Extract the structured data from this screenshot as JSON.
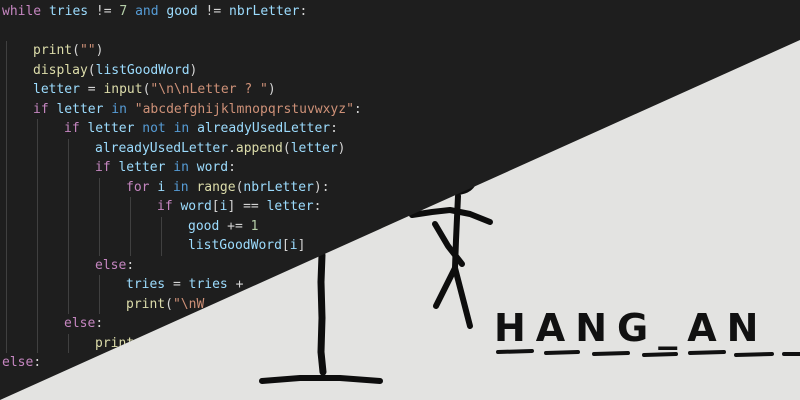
{
  "code_lines": [
    {
      "indent": 0,
      "tokens": [
        [
          "kw",
          "while"
        ],
        [
          "op",
          " "
        ],
        [
          "var",
          "tries"
        ],
        [
          "op",
          " != "
        ],
        [
          "num",
          "7"
        ],
        [
          "op",
          " "
        ],
        [
          "kb",
          "and"
        ],
        [
          "op",
          " "
        ],
        [
          "var",
          "good"
        ],
        [
          "op",
          " != "
        ],
        [
          "var",
          "nbrLetter"
        ],
        [
          "op",
          ":"
        ]
      ]
    },
    {
      "indent": 0,
      "tokens": []
    },
    {
      "indent": 1,
      "tokens": [
        [
          "fn",
          "print"
        ],
        [
          "op",
          "("
        ],
        [
          "str",
          "\"\""
        ],
        [
          "op",
          ")"
        ]
      ]
    },
    {
      "indent": 1,
      "tokens": [
        [
          "fn",
          "display"
        ],
        [
          "op",
          "("
        ],
        [
          "var",
          "listGoodWord"
        ],
        [
          "op",
          ")"
        ]
      ]
    },
    {
      "indent": 1,
      "tokens": [
        [
          "var",
          "letter"
        ],
        [
          "op",
          " = "
        ],
        [
          "fn",
          "input"
        ],
        [
          "op",
          "("
        ],
        [
          "str",
          "\"\\n\\nLetter ? \""
        ],
        [
          "op",
          ")"
        ]
      ]
    },
    {
      "indent": 1,
      "tokens": [
        [
          "kw",
          "if"
        ],
        [
          "op",
          " "
        ],
        [
          "var",
          "letter"
        ],
        [
          "op",
          " "
        ],
        [
          "kb",
          "in"
        ],
        [
          "op",
          " "
        ],
        [
          "str",
          "\"abcdefghijklmnopqrstuvwxyz\""
        ],
        [
          "op",
          ":"
        ]
      ]
    },
    {
      "indent": 2,
      "tokens": [
        [
          "kw",
          "if"
        ],
        [
          "op",
          " "
        ],
        [
          "var",
          "letter"
        ],
        [
          "op",
          " "
        ],
        [
          "kb",
          "not"
        ],
        [
          "op",
          " "
        ],
        [
          "kb",
          "in"
        ],
        [
          "op",
          " "
        ],
        [
          "var",
          "alreadyUsedLetter"
        ],
        [
          "op",
          ":"
        ]
      ]
    },
    {
      "indent": 3,
      "tokens": [
        [
          "var",
          "alreadyUsedLetter"
        ],
        [
          "op",
          "."
        ],
        [
          "fn",
          "append"
        ],
        [
          "op",
          "("
        ],
        [
          "var",
          "letter"
        ],
        [
          "op",
          ")"
        ]
      ]
    },
    {
      "indent": 3,
      "tokens": [
        [
          "kw",
          "if"
        ],
        [
          "op",
          " "
        ],
        [
          "var",
          "letter"
        ],
        [
          "op",
          " "
        ],
        [
          "kb",
          "in"
        ],
        [
          "op",
          " "
        ],
        [
          "var",
          "word"
        ],
        [
          "op",
          ":"
        ]
      ]
    },
    {
      "indent": 4,
      "tokens": [
        [
          "kw",
          "for"
        ],
        [
          "op",
          " "
        ],
        [
          "var",
          "i"
        ],
        [
          "op",
          " "
        ],
        [
          "kb",
          "in"
        ],
        [
          "op",
          " "
        ],
        [
          "fn",
          "range"
        ],
        [
          "op",
          "("
        ],
        [
          "var",
          "nbrLetter"
        ],
        [
          "op",
          "):"
        ]
      ]
    },
    {
      "indent": 5,
      "tokens": [
        [
          "kw",
          "if"
        ],
        [
          "op",
          " "
        ],
        [
          "var",
          "word"
        ],
        [
          "op",
          "["
        ],
        [
          "var",
          "i"
        ],
        [
          "op",
          "] == "
        ],
        [
          "var",
          "letter"
        ],
        [
          "op",
          ":"
        ]
      ]
    },
    {
      "indent": 6,
      "tokens": [
        [
          "var",
          "good"
        ],
        [
          "op",
          " += "
        ],
        [
          "num",
          "1"
        ]
      ]
    },
    {
      "indent": 6,
      "tokens": [
        [
          "var",
          "listGoodWord"
        ],
        [
          "op",
          "["
        ],
        [
          "var",
          "i"
        ],
        [
          "op",
          "]"
        ]
      ]
    },
    {
      "indent": 3,
      "tokens": [
        [
          "kw",
          "else"
        ],
        [
          "op",
          ":"
        ]
      ]
    },
    {
      "indent": 4,
      "tokens": [
        [
          "var",
          "tries"
        ],
        [
          "op",
          " = "
        ],
        [
          "var",
          "tries"
        ],
        [
          "op",
          " +"
        ]
      ]
    },
    {
      "indent": 4,
      "tokens": [
        [
          "fn",
          "print"
        ],
        [
          "op",
          "("
        ],
        [
          "str",
          "\"\\nW"
        ]
      ]
    },
    {
      "indent": 2,
      "tokens": [
        [
          "kw",
          "else"
        ],
        [
          "op",
          ":"
        ]
      ]
    },
    {
      "indent": 3,
      "tokens": [
        [
          "fn",
          "print"
        ]
      ]
    },
    {
      "indent": 0,
      "tokens": [
        [
          "kw",
          "else"
        ],
        [
          "op",
          ":"
        ]
      ]
    }
  ],
  "sketch_title": "HANG_AN"
}
